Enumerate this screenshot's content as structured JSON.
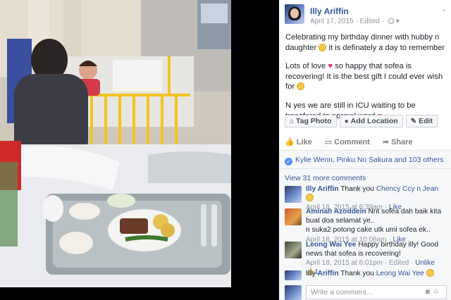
{
  "post": {
    "author": "Illy Ariffin",
    "date": "April 17, 2015",
    "edited": "Edited",
    "separator": "·",
    "text_1a": "Celebrating my birthday dinner with hubby n daughter",
    "text_1b": "it is definately a day to remember",
    "text_2a": "Lots of love",
    "text_2b": "so happy that sofea is recovering! It is the best gift I could ever wish for",
    "text_3a": "N yes we are still in ICU waiting to be transfered to normal ward",
    "heart": "♥"
  },
  "buttons": {
    "tag_photo": "Tag Photo",
    "add_location": "Add Location",
    "edit": "Edit"
  },
  "actions": {
    "like": "Like",
    "comment": "Comment",
    "share": "Share"
  },
  "likes": {
    "text": "Kylie Wenn, Pinku No Sakura and 103 others"
  },
  "view_more": "View 31 more comments",
  "comments": [
    {
      "name": "Illy Ariffin",
      "text_a": "Thank you",
      "link": "Chency Ccy n Jean",
      "date": "April 18, 2015 at 6:39am",
      "dot": "·",
      "like": "Like"
    },
    {
      "name": "Aminah Azoddein",
      "text": "Nnt sofea dah baik kita buat doa selamat ye..",
      "text2": "n suka2 potong cake utk umi sofea ek..",
      "date": "April 18, 2015 at 10:06am",
      "dot": "·",
      "like": "Like"
    },
    {
      "name": "Leong Wai Yee",
      "text": "Happy birthday illy! Good news that sofea is recovering!",
      "date": "April 18, 2015 at 6:01pm",
      "dot": "·",
      "edited": "Edited",
      "unlike": "Unlike",
      "count": "1"
    },
    {
      "name": "Illy Ariffin",
      "text_a": "Thank you",
      "link": "Leong Wai Yee"
    }
  ],
  "write_placeholder": "Write a comment...",
  "icons": {
    "tag": "tag-icon",
    "location": "location-pin-icon",
    "edit": "pencil-icon",
    "like": "thumbs-up-icon",
    "comment": "speech-bubble-icon",
    "share": "share-arrow-icon",
    "camera": "camera-icon",
    "emoji": "emoji-icon"
  },
  "colors": {
    "link": "#365899",
    "meta": "#90949c",
    "heart": "#e0245e",
    "like_blue": "#5890ff"
  }
}
